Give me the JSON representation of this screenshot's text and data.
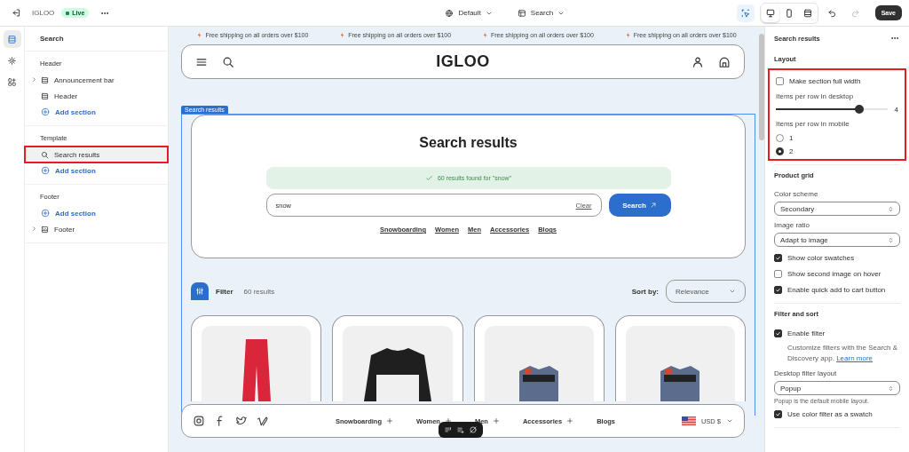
{
  "topbar": {
    "store_name": "IGLOO",
    "status": "Live",
    "theme": "Default",
    "template": "Search",
    "save": "Save",
    "tools": [
      {
        "kind": "inspector",
        "selected": true
      },
      {
        "kind": "desktop",
        "selected": true
      },
      {
        "kind": "mobile",
        "selected": false
      },
      {
        "kind": "fullscreen",
        "selected": false
      }
    ]
  },
  "rail": [
    {
      "kind": "sections",
      "selected": true
    },
    {
      "kind": "settings",
      "selected": false
    },
    {
      "kind": "apps",
      "selected": false
    }
  ],
  "sidebar": {
    "title": "Search",
    "groups": [
      {
        "title": "Header",
        "items": [
          {
            "label": "Announcement bar",
            "kind": "bar",
            "expandable": true,
            "selected": false,
            "highlighted": false
          },
          {
            "label": "Header",
            "kind": "bar",
            "expandable": false,
            "selected": false,
            "highlighted": false
          },
          {
            "label": "Add section",
            "kind": "add",
            "expandable": false,
            "selected": false,
            "highlighted": false
          }
        ]
      },
      {
        "title": "Template",
        "items": [
          {
            "label": "Search results",
            "kind": "search",
            "expandable": false,
            "selected": true,
            "highlighted": true
          },
          {
            "label": "Add section",
            "kind": "add",
            "expandable": false,
            "selected": false,
            "highlighted": false
          }
        ]
      },
      {
        "title": "Footer",
        "items": [
          {
            "label": "Add section",
            "kind": "add",
            "expandable": false,
            "selected": false,
            "highlighted": false
          },
          {
            "label": "Footer",
            "kind": "footer",
            "expandable": true,
            "selected": false,
            "highlighted": false
          }
        ]
      }
    ]
  },
  "preview": {
    "announcements": [
      "Free shipping on all orders over $100",
      "Free shipping on all orders over $100",
      "Free shipping on all orders over $100",
      "Free shipping on all orders over $100"
    ],
    "logo": "IGLOO",
    "section_tag": "Search results",
    "heading": "Search results",
    "result_message": "60 results found for \"snow\"",
    "search_value": "snow",
    "clear": "Clear",
    "search_button": "Search",
    "links": [
      "Snowboarding",
      "Women",
      "Men",
      "Accessories",
      "Blogs"
    ],
    "filter": "Filter",
    "result_count": "60 results",
    "sort_label": "Sort by:",
    "sort_value": "Relevance",
    "products": [
      {
        "kind": "pants"
      },
      {
        "kind": "sweater"
      },
      {
        "kind": "boots"
      },
      {
        "kind": "boots"
      }
    ],
    "footer_menu": [
      {
        "label": "Snowboarding",
        "expandable": true
      },
      {
        "label": "Women",
        "expandable": true
      },
      {
        "label": "Men",
        "expandable": true
      },
      {
        "label": "Accessories",
        "expandable": true
      },
      {
        "label": "Blogs",
        "expandable": false
      }
    ],
    "currency": "USD $"
  },
  "settings": {
    "title": "Search results",
    "groups": [
      {
        "title": "Layout",
        "highlighted": true,
        "items": [
          {
            "kind": "checkbox",
            "label": "Make section full width",
            "checked": false
          },
          {
            "kind": "slider",
            "label": "Items per row in desktop",
            "level": 0.75,
            "reading": "4"
          },
          {
            "kind": "radio",
            "label": "Items per row in mobile",
            "options": [
              {
                "label": "1",
                "selected": false
              },
              {
                "label": "2",
                "selected": true
              }
            ]
          }
        ]
      },
      {
        "title": "Product grid",
        "highlighted": false,
        "items": [
          {
            "kind": "select",
            "label": "Color scheme",
            "value": "Secondary"
          },
          {
            "kind": "select",
            "label": "Image ratio",
            "value": "Adapt to image"
          },
          {
            "kind": "checkbox",
            "label": "Show color swatches",
            "checked": true
          },
          {
            "kind": "checkbox",
            "label": "Show second image on hover",
            "checked": false
          },
          {
            "kind": "checkbox",
            "label": "Enable quick add to cart button",
            "checked": true
          }
        ]
      },
      {
        "title": "Filter and sort",
        "highlighted": false,
        "items": [
          {
            "kind": "checkbox",
            "label": "Enable filter",
            "checked": true,
            "help": "Customize filters with the Search & Discovery app.",
            "link": "Learn more"
          },
          {
            "kind": "select",
            "label": "Desktop filter layout",
            "value": "Popup",
            "help": "Popup is the default mobile layout."
          },
          {
            "kind": "checkbox",
            "label": "Use color filter as a swatch",
            "checked": true
          }
        ]
      }
    ]
  }
}
